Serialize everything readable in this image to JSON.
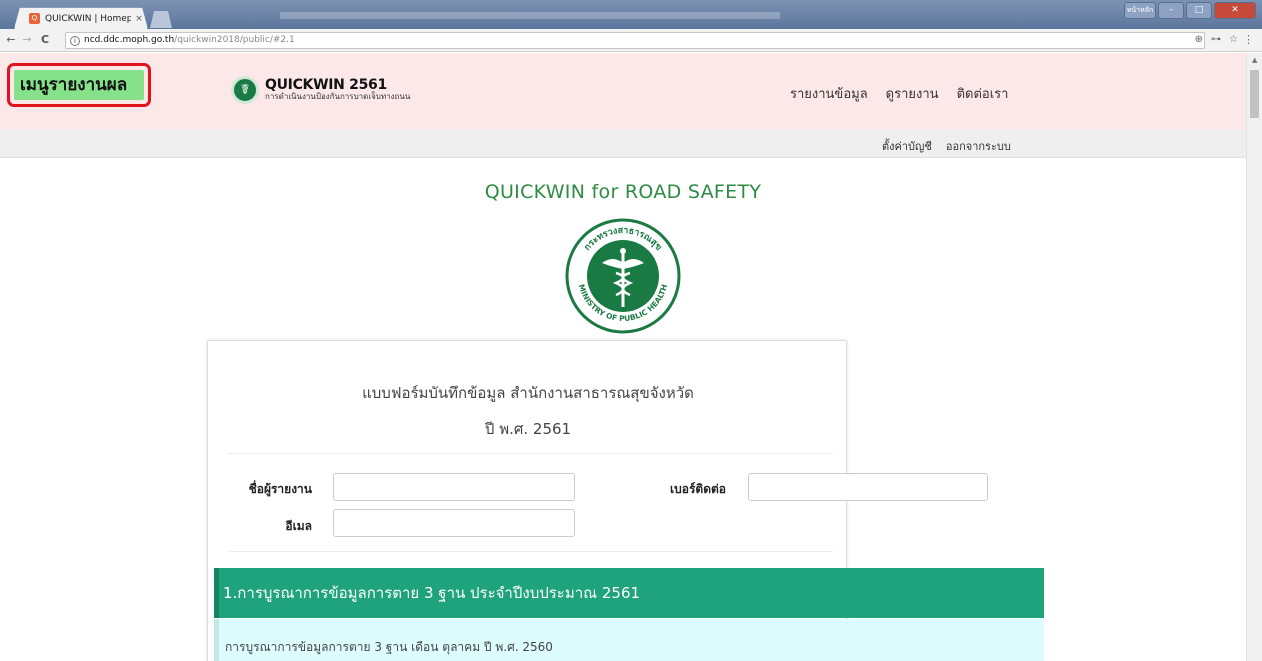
{
  "browser": {
    "tab_title": "QUICKWIN | Homepage",
    "tab_close": "×",
    "url_host": "ncd.ddc.moph.go.th",
    "url_path": "/quickwin2018/public/#2.1",
    "back": "←",
    "forward": "→",
    "reload": "C",
    "info": "i",
    "addr_icons": [
      "⊕",
      "⊶",
      "☆"
    ],
    "menu": "⋮",
    "win_user": "หน้าหลัก",
    "win_min": "–",
    "win_max": "□",
    "win_close": "✕"
  },
  "navbar": {
    "report_menu": "เมนูรายงานผล",
    "brand_title": "QUICKWIN 2561",
    "brand_sub": "การดำเนินงานป้องกันการบาดเจ็บทางถนน",
    "links": [
      "รายงานข้อมูล",
      "ดูรายงาน",
      "ติดต่อเรา"
    ]
  },
  "subnav": {
    "links": [
      "ตั้งค่าบัญชี",
      "ออกจากระบบ"
    ]
  },
  "page": {
    "title": "QUICKWIN for ROAD SAFETY",
    "logo_ring_text": "กระทรวงสาธารณสุข",
    "logo_ring_text_en": "MINISTRY OF PUBLIC HEALTH"
  },
  "form": {
    "title": "แบบฟอร์มบันทึกข้อมูล สำนักงานสาธารณสุขจังหวัด",
    "year": "ปี พ.ศ. 2561",
    "reporter_label": "ชื่อผู้รายงาน",
    "reporter_value": "",
    "phone_label": "เบอร์ติดต่อ",
    "phone_value": "",
    "email_label": "อีเมล",
    "email_value": "",
    "section1_title": "1.การบูรณาการข้อมูลการตาย 3 ฐาน ประจำปีงบประมาณ 2561",
    "section1_sub": "การบูรณาการข้อมูลการตาย 3 ฐาน เดือน ตุลาคม ปี พ.ศ. 2560"
  },
  "colors": {
    "navbar_bg": "#fde8e9",
    "report_menu_bg": "#85e28b",
    "report_menu_border": "#e0141c",
    "title_green": "#2e8b44",
    "section_green": "#1ea37c",
    "sub_row_bg": "#ddfcfd"
  }
}
